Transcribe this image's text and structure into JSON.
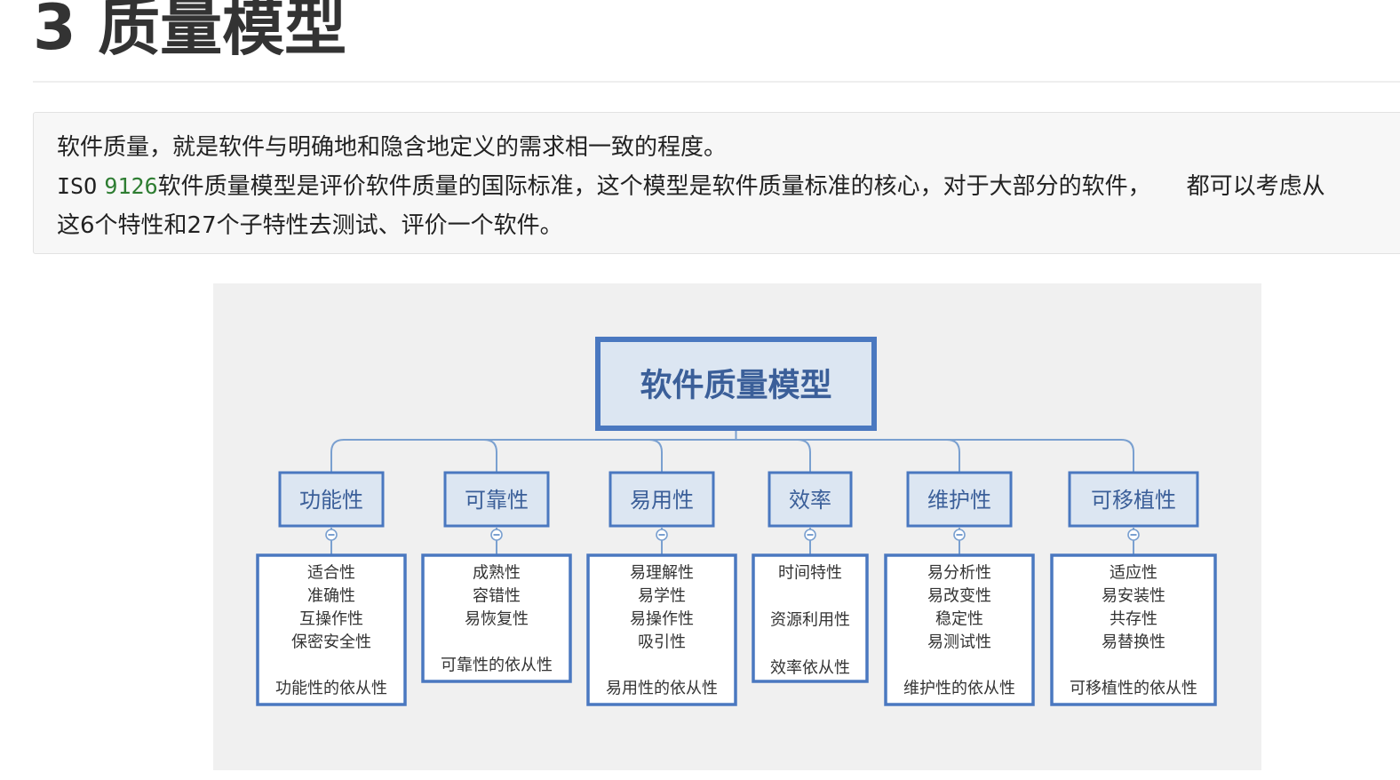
{
  "heading": {
    "number": "3",
    "title": "质量模型"
  },
  "intro": {
    "line1": "软件质量，就是软件与明确地和隐含地定义的需求相一致的程度。",
    "line2_prefix": "ISO",
    "line2_number": "9126",
    "line2_text": "软件质量模型是评价软件质量的国际标准，这个模型是软件质量标准的核心，对于大部分的软件，",
    "line2_tail": "都可以考虑从",
    "line3": "这6个特性和27个子特性去测试、评价一个软件。"
  },
  "diagram": {
    "root": "软件质量模型",
    "colors": {
      "box_border": "#4a78c0",
      "box_fill": "#dce6f2",
      "text": "#3b5f99",
      "connector": "#7aa0d0",
      "background": "#f0f0f0"
    },
    "characteristics": [
      {
        "name": "功能性",
        "subs": [
          "适合性",
          "准确性",
          "互操作性",
          "保密安全性"
        ],
        "compliance": "功能性的依从性"
      },
      {
        "name": "可靠性",
        "subs": [
          "成熟性",
          "容错性",
          "易恢复性"
        ],
        "compliance": "可靠性的依从性"
      },
      {
        "name": "易用性",
        "subs": [
          "易理解性",
          "易学性",
          "易操作性",
          "吸引性"
        ],
        "compliance": "易用性的依从性"
      },
      {
        "name": "效率",
        "subs": [
          "时间特性",
          "资源利用性"
        ],
        "compliance": "效率依从性"
      },
      {
        "name": "维护性",
        "subs": [
          "易分析性",
          "易改变性",
          "稳定性",
          "易测试性"
        ],
        "compliance": "维护性的依从性"
      },
      {
        "name": "可移植性",
        "subs": [
          "适应性",
          "易安装性",
          "共存性",
          "易替换性"
        ],
        "compliance": "可移植性的依从性"
      }
    ]
  }
}
